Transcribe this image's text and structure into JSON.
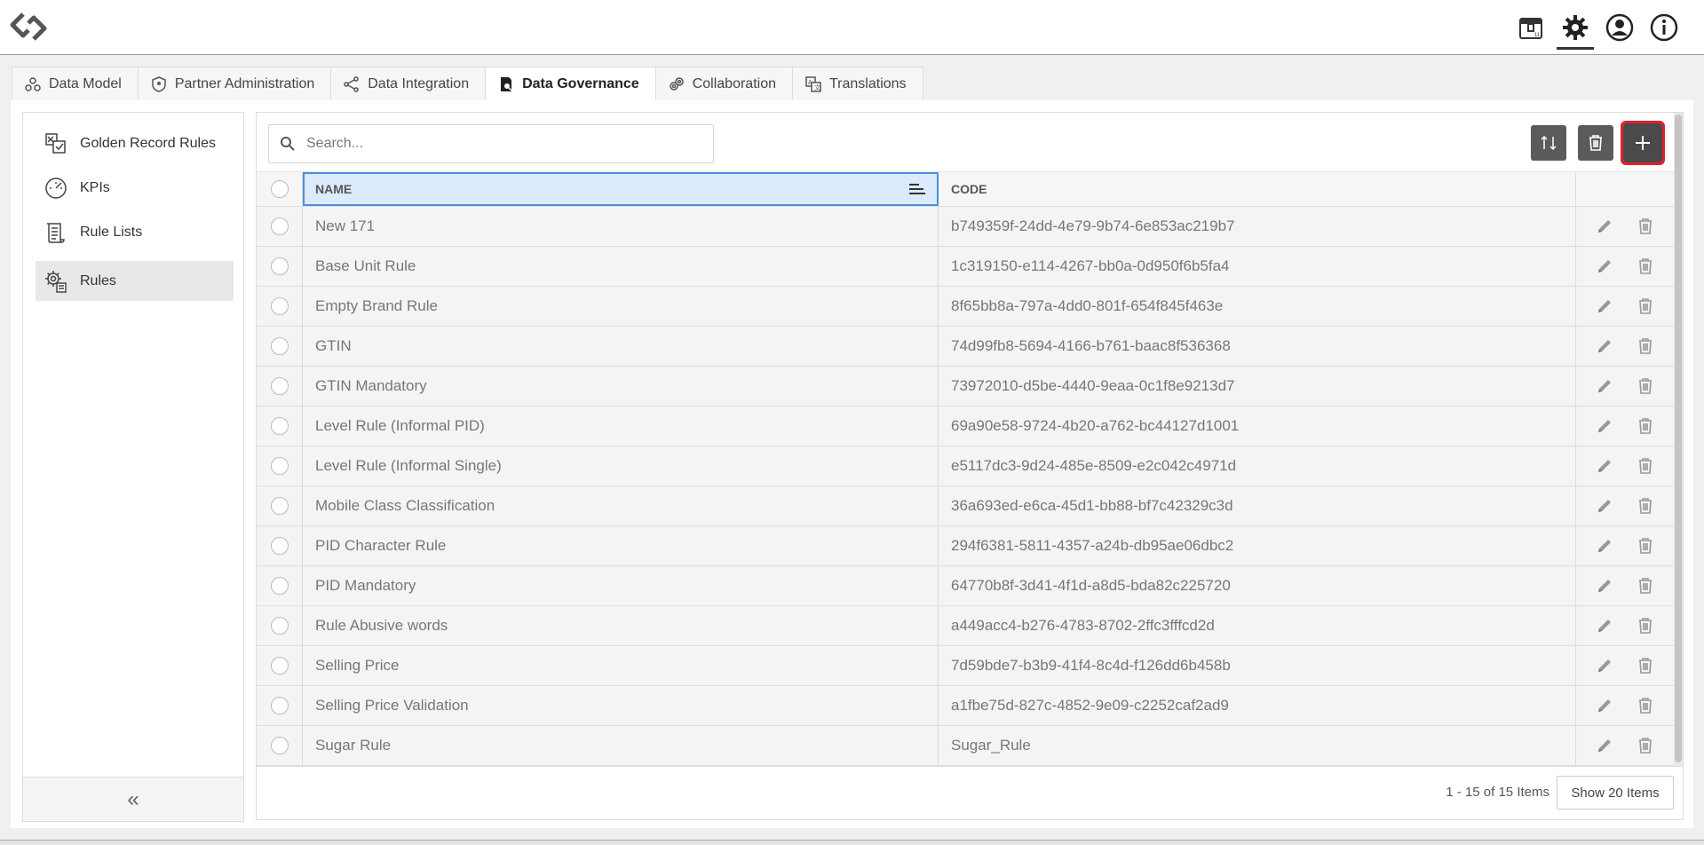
{
  "app": {
    "logo": "logo-icon"
  },
  "topbar": {
    "icons": [
      {
        "name": "package-icon"
      },
      {
        "name": "settings-icon",
        "active": true
      },
      {
        "name": "user-icon"
      },
      {
        "name": "info-icon"
      }
    ]
  },
  "tabs": [
    {
      "label": "Data Model",
      "icon": "data-model-icon"
    },
    {
      "label": "Partner Administration",
      "icon": "shield-icon"
    },
    {
      "label": "Data Integration",
      "icon": "integration-icon"
    },
    {
      "label": "Data Governance",
      "icon": "governance-icon",
      "active": true
    },
    {
      "label": "Collaboration",
      "icon": "collaboration-icon"
    },
    {
      "label": "Translations",
      "icon": "translate-icon"
    }
  ],
  "sidebar": {
    "items": [
      {
        "label": "Golden Record Rules",
        "icon": "golden-record-icon"
      },
      {
        "label": "KPIs",
        "icon": "gauge-icon"
      },
      {
        "label": "Rule Lists",
        "icon": "list-icon"
      },
      {
        "label": "Rules",
        "icon": "gear-rules-icon",
        "active": true
      }
    ],
    "collapse_label": "«"
  },
  "search": {
    "placeholder": "Search..."
  },
  "toolbar": {
    "refresh": "refresh-icon",
    "delete": "trash-icon",
    "add": "plus-icon"
  },
  "grid": {
    "columns": {
      "name": "NAME",
      "code": "CODE"
    },
    "rows": [
      {
        "name": "New 171",
        "code": "b749359f-24dd-4e79-9b74-6e853ac219b7"
      },
      {
        "name": "Base Unit Rule",
        "code": "1c319150-e114-4267-bb0a-0d950f6b5fa4"
      },
      {
        "name": "Empty Brand Rule",
        "code": "8f65bb8a-797a-4dd0-801f-654f845f463e"
      },
      {
        "name": "GTIN",
        "code": "74d99fb8-5694-4166-b761-baac8f536368"
      },
      {
        "name": "GTIN Mandatory",
        "code": "73972010-d5be-4440-9eaa-0c1f8e9213d7"
      },
      {
        "name": "Level Rule (Informal PID)",
        "code": "69a90e58-9724-4b20-a762-bc44127d1001"
      },
      {
        "name": "Level Rule (Informal Single)",
        "code": "e5117dc3-9d24-485e-8509-e2c042c4971d"
      },
      {
        "name": "Mobile Class Classification",
        "code": "36a693ed-e6ca-45d1-bb88-bf7c42329c3d"
      },
      {
        "name": "PID Character Rule",
        "code": "294f6381-5811-4357-a24b-db95ae06dbc2"
      },
      {
        "name": "PID Mandatory",
        "code": "64770b8f-3d41-4f1d-a8d5-bda82c225720"
      },
      {
        "name": "Rule Abusive words",
        "code": "a449acc4-b276-4783-8702-2ffc3fffcd2d"
      },
      {
        "name": "Selling Price",
        "code": "7d59bde7-b3b9-41f4-8c4d-f126dd6b458b"
      },
      {
        "name": "Selling Price Validation",
        "code": "a1fbe75d-827c-4852-9e09-c2252caf2ad9"
      },
      {
        "name": "Sugar Rule",
        "code": "Sugar_Rule"
      }
    ]
  },
  "pager": {
    "count": "1 - 15 of 15 Items",
    "page_size": "Show 20 Items"
  },
  "colors": {
    "accent_border": "#e0202a",
    "selected_header": "#dbeafc",
    "button_dark": "#5b5b5b"
  }
}
